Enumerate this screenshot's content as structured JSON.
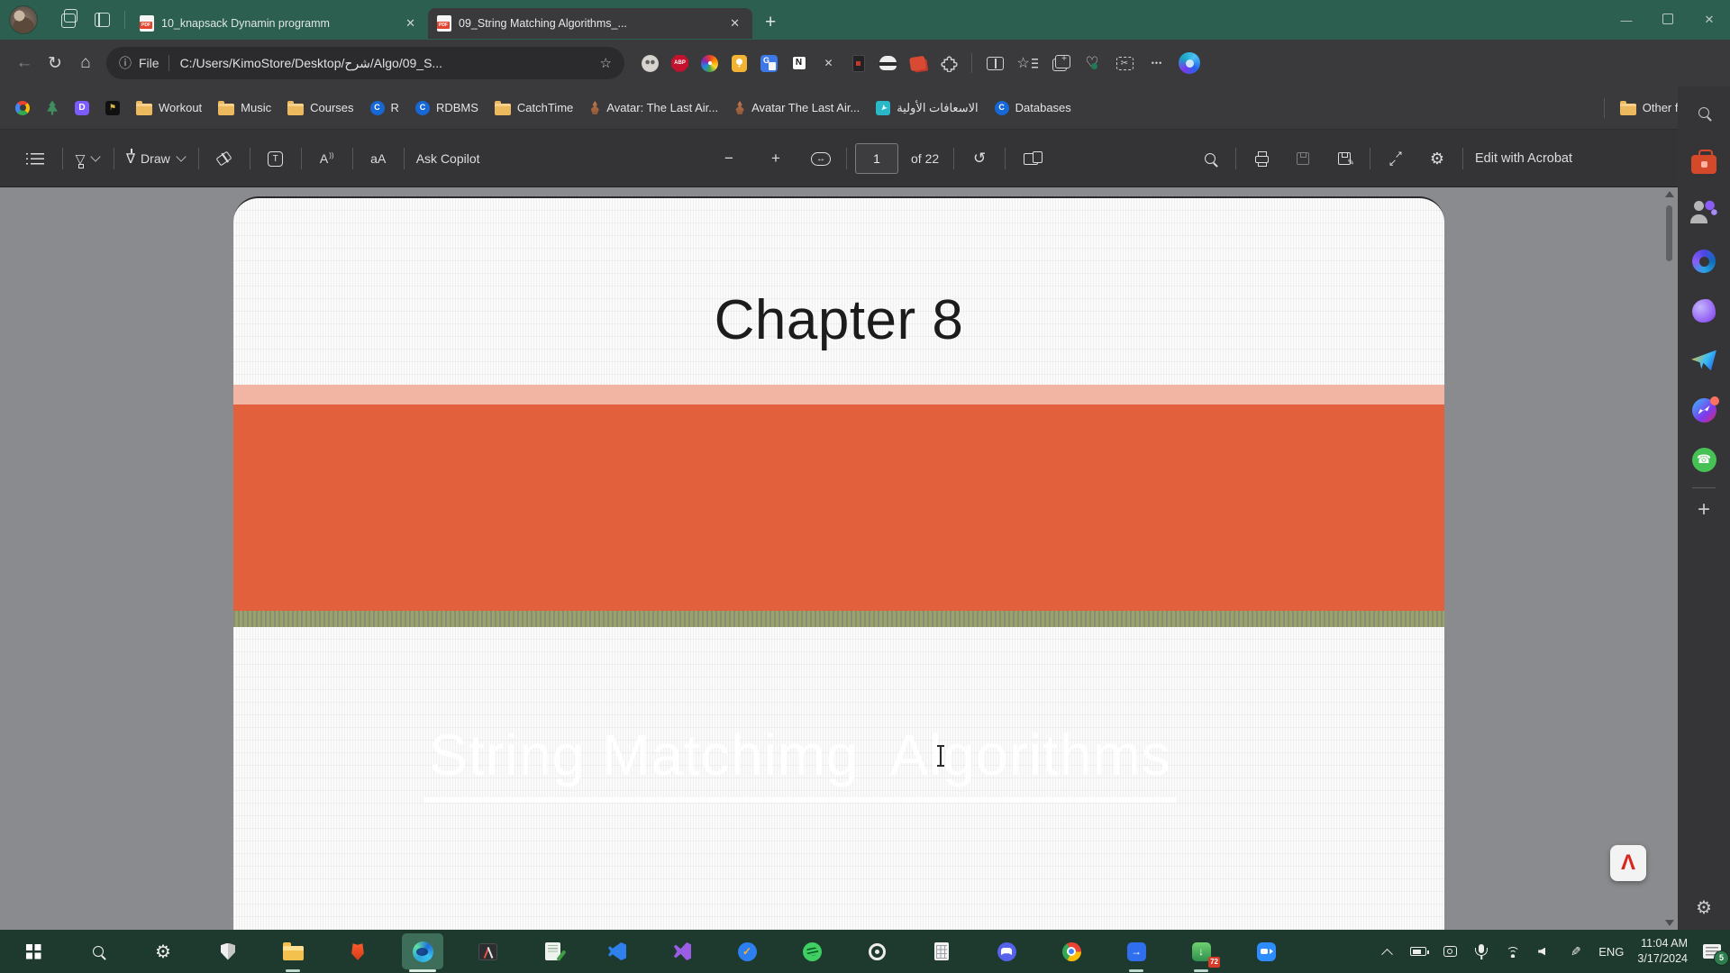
{
  "window": {
    "tab_bar_color": "#2d5f51",
    "taskbar_color": "#1e3a2e"
  },
  "tabs": [
    {
      "name": "tab-knapsack",
      "label": "10_knapsack Dynamin programm",
      "active": false
    },
    {
      "name": "tab-string-matching",
      "label": "09_String Matching Algorithms_...",
      "active": true
    }
  ],
  "toolbar": {
    "address": {
      "scheme": "File",
      "url": "C:/Users/KimoStore/Desktop/شرح/Algo/09_S..."
    },
    "extensions": [
      {
        "name": "extension-tampermonkey",
        "icon": "ic-monkey"
      },
      {
        "name": "extension-adblock-plus",
        "icon": "ic-abp"
      },
      {
        "name": "extension-color-pinwheel",
        "icon": "ic-pinwheel"
      },
      {
        "name": "extension-lightbulb",
        "icon": "ic-bulb"
      },
      {
        "name": "extension-google-translate",
        "icon": "ic-gtranslate"
      },
      {
        "name": "extension-notion",
        "icon": "ic-notion"
      },
      {
        "name": "extension-x",
        "icon": "ic-x"
      },
      {
        "name": "extension-dark-document",
        "icon": "ic-darkdoc"
      },
      {
        "name": "extension-incognito",
        "icon": "ic-incog"
      },
      {
        "name": "extension-red-clipper",
        "icon": "ic-redblob"
      }
    ]
  },
  "bookmarks": {
    "items": [
      {
        "name": "bookmark-google",
        "icon": "ic-google",
        "label": ""
      },
      {
        "name": "bookmark-tree-app",
        "icon": "ic-tree",
        "label": ""
      },
      {
        "name": "bookmark-purple-app",
        "icon": "ic-appD",
        "label": ""
      },
      {
        "name": "bookmark-flag-app",
        "icon": "ic-flagapp",
        "label": ""
      },
      {
        "name": "bookmark-folder-workout",
        "icon": "ic-folder",
        "label": "Workout"
      },
      {
        "name": "bookmark-folder-music",
        "icon": "ic-folder",
        "label": "Music"
      },
      {
        "name": "bookmark-folder-courses",
        "icon": "ic-folder",
        "label": "Courses"
      },
      {
        "name": "bookmark-r",
        "icon": "ic-cblue",
        "label": "R"
      },
      {
        "name": "bookmark-rdbms",
        "icon": "ic-cblue",
        "label": "RDBMS"
      },
      {
        "name": "bookmark-folder-catchtime",
        "icon": "ic-folder",
        "label": "CatchTime"
      },
      {
        "name": "bookmark-avatar-last-airbender-1",
        "icon": "ic-flame",
        "label": "Avatar: The Last Air..."
      },
      {
        "name": "bookmark-avatar-last-airbender-2",
        "icon": "ic-flame",
        "label": "Avatar The Last Air..."
      },
      {
        "name": "bookmark-first-aid",
        "icon": "ic-karrow",
        "label": "الاسعافات الأولية"
      },
      {
        "name": "bookmark-databases",
        "icon": "ic-cblue",
        "label": "Databases"
      }
    ],
    "other_favorites_label": "Other favorites"
  },
  "pdf_toolbar": {
    "draw_label": "Draw",
    "ask_copilot_label": "Ask Copilot",
    "translate_glyph": "aA",
    "minus_glyph": "−",
    "plus_glyph": "+",
    "page_current": "1",
    "page_total_label": "of 22",
    "edit_with_acrobat_label": "Edit with Acrobat"
  },
  "document": {
    "chapter_title": "Chapter 8",
    "slide_title": "String Matchimg  Algorithms",
    "banner_color": "#e2603c",
    "pink_strip_color": "#f2b5a4",
    "olive_strip_color": "#9aa36b",
    "acrobat_mark": "Λ"
  },
  "sidebar": {
    "icons": [
      {
        "name": "sidebar-search",
        "icon": "i-mag grey"
      },
      {
        "name": "sidebar-acrobat-toolbox",
        "icon": "ic-toolbox"
      },
      {
        "name": "sidebar-persona-avatar",
        "icon": "ic-persona"
      },
      {
        "name": "sidebar-microsoft-365",
        "icon": "ic-m365"
      },
      {
        "name": "sidebar-designer",
        "icon": "ic-dragon"
      },
      {
        "name": "sidebar-telegram",
        "icon": "ic-plane"
      },
      {
        "name": "sidebar-messenger",
        "icon": "ic-messenger"
      },
      {
        "name": "sidebar-whatsapp",
        "icon": "ic-whatsapp"
      }
    ]
  },
  "taskbar": {
    "apps": [
      {
        "name": "taskbar-start",
        "icon": "ic-win"
      },
      {
        "name": "taskbar-search",
        "icon": "i-mag white"
      },
      {
        "name": "taskbar-settings",
        "icon": "ic-tgear"
      },
      {
        "name": "taskbar-defender",
        "icon": "ic-shield"
      },
      {
        "name": "taskbar-file-explorer",
        "icon": "ic-tfolder",
        "running": true
      },
      {
        "name": "taskbar-brave",
        "icon": "ic-brave"
      },
      {
        "name": "taskbar-edge",
        "icon": "ic-edge",
        "active": true,
        "running": true
      },
      {
        "name": "taskbar-toolbox-app",
        "icon": "ic-toolcase"
      },
      {
        "name": "taskbar-notes-app",
        "icon": "ic-notepadg"
      },
      {
        "name": "taskbar-vscode",
        "icon": "ic-vscode"
      },
      {
        "name": "taskbar-visual-studio",
        "icon": "ic-vstudio"
      },
      {
        "name": "taskbar-ticktick",
        "icon": "ic-ticktick"
      },
      {
        "name": "taskbar-spotify",
        "icon": "ic-spotify"
      },
      {
        "name": "taskbar-recorder",
        "icon": "ic-record"
      },
      {
        "name": "taskbar-calculator",
        "icon": "ic-calc"
      },
      {
        "name": "taskbar-discord",
        "icon": "ic-discord"
      },
      {
        "name": "taskbar-chrome",
        "icon": "ic-chrome"
      },
      {
        "name": "taskbar-movies-app",
        "icon": "ic-bluefwd",
        "running": true
      },
      {
        "name": "taskbar-idm",
        "icon": "ic-idm",
        "badge": "72",
        "running": true
      },
      {
        "name": "taskbar-zoom",
        "icon": "ic-zoom"
      }
    ],
    "tray": {
      "language": "ENG",
      "time": "11:04 AM",
      "date": "3/17/2024",
      "notification_count": "5"
    }
  }
}
